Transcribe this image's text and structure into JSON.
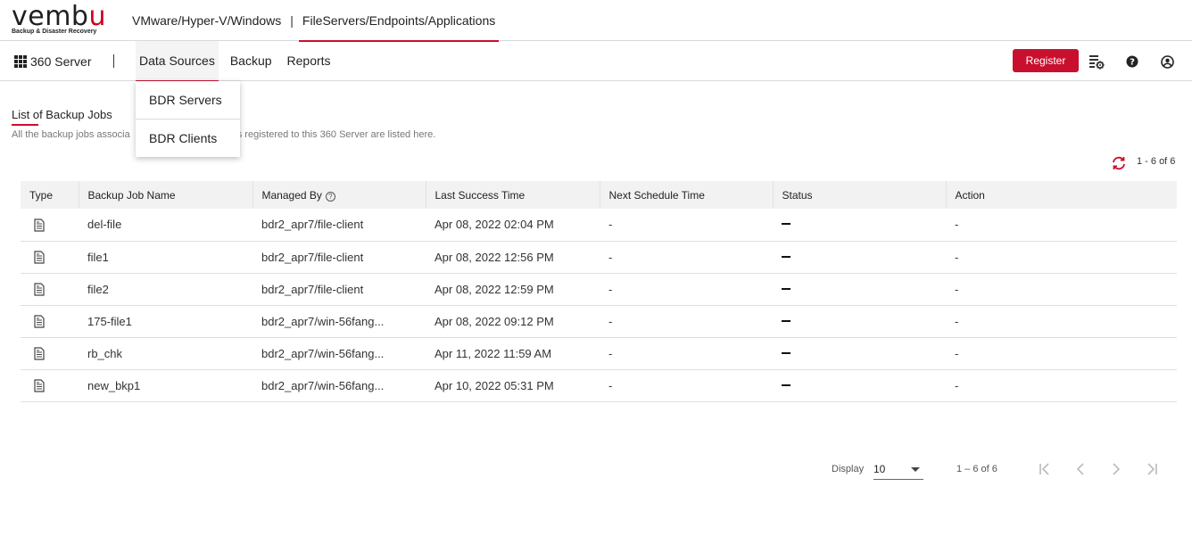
{
  "brand": {
    "logo_text_main": "vemb",
    "logo_text_accent": "u",
    "tagline": "Backup & Disaster Recovery"
  },
  "top_tabs": [
    {
      "label": "VMware/Hyper-V/Windows"
    },
    {
      "label": "FileServers/Endpoints/Applications"
    }
  ],
  "top_sep": "|",
  "navbar": {
    "app_name": "360 Server",
    "items": [
      {
        "label": "Data Sources"
      },
      {
        "label": "Backup"
      },
      {
        "label": "Reports"
      }
    ],
    "register_label": "Register"
  },
  "dropdown": {
    "items": [
      {
        "label": "BDR Servers"
      },
      {
        "label": "BDR Clients"
      }
    ]
  },
  "page": {
    "title": "List of Backup Jobs",
    "subtitle_left": "All the backup jobs associa",
    "subtitle_right": "ervers registered to this 360 Server are listed here.",
    "range_top": "1 - 6 of 6"
  },
  "table": {
    "columns": [
      "Type",
      "Backup Job Name",
      "Managed By",
      "Last Success Time",
      "Next Schedule Time",
      "Status",
      "Action"
    ],
    "rows": [
      {
        "name": "del-file",
        "managed_by": "bdr2_apr7/file-client",
        "last_success": "Apr 08, 2022 02:04 PM",
        "next_schedule": "-",
        "action": "-"
      },
      {
        "name": "file1",
        "managed_by": "bdr2_apr7/file-client",
        "last_success": "Apr 08, 2022 12:56 PM",
        "next_schedule": "-",
        "action": "-"
      },
      {
        "name": "file2",
        "managed_by": "bdr2_apr7/file-client",
        "last_success": "Apr 08, 2022 12:59 PM",
        "next_schedule": "-",
        "action": "-"
      },
      {
        "name": "175-file1",
        "managed_by": "bdr2_apr7/win-56fang...",
        "last_success": "Apr 08, 2022 09:12 PM",
        "next_schedule": "-",
        "action": "-"
      },
      {
        "name": "rb_chk",
        "managed_by": "bdr2_apr7/win-56fang...",
        "last_success": "Apr 11, 2022 11:59 AM",
        "next_schedule": "-",
        "action": "-"
      },
      {
        "name": "new_bkp1",
        "managed_by": "bdr2_apr7/win-56fang...",
        "last_success": "Apr 10, 2022 05:31 PM",
        "next_schedule": "-",
        "action": "-"
      }
    ]
  },
  "pagination": {
    "display_label": "Display",
    "page_size": "10",
    "range": "1 – 6 of 6"
  },
  "colors": {
    "accent": "#c8102e",
    "header_bg": "#f2f2f2"
  }
}
